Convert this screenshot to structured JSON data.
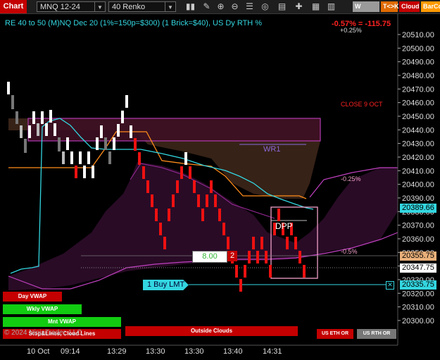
{
  "toolbar": {
    "chart_button": "Chart",
    "symbol": "MNQ 12-24",
    "bar_type": "40 Renko",
    "pills": {
      "vwap": "W VWAP",
      "tk": "T<>K",
      "cloud": "Cloud",
      "barco": "BarCo"
    },
    "icons": [
      "bar-style-icon",
      "drawing-tools-icon",
      "zoom-in-icon",
      "zoom-out-icon",
      "properties-icon",
      "strategy-icon",
      "template-icon",
      "global-draw-icon",
      "data-box-icon",
      "chart-trader-icon"
    ]
  },
  "header": {
    "title": "RE 40 to 50 (M)NQ Dec 20 (1%=150p=$300) (1 Brick=$40), US Dy RTH %",
    "change_top": "-0.57% = -115.75",
    "change_pct": "+0.25%"
  },
  "chart_labels": {
    "close": "CLOSE 9 OCT",
    "wr1": "WR1",
    "dpp": "DPP",
    "minus025": "-0.25%",
    "minus05": "-0.5%",
    "one_buy_lmt": "1 Buy LMT",
    "order_qty": "8.00",
    "order_count": "2",
    "copyright": "© 2024 NinjaTrader, LLC"
  },
  "legend_buttons": {
    "day_vwap": "Day VWAP",
    "wkly_vwap": "Wkly VWAP",
    "mnt_vwap": "Mnt VWAP",
    "stop_lines": "Stop&Lines, Cloud Lines",
    "outside_clouds": "Outside Clouds",
    "us_eth_or": "US ETH OR",
    "us_rth_or": "US RTH OR"
  },
  "price_axis": {
    "ticks": [
      "20510.00",
      "20500.00",
      "20490.00",
      "20480.00",
      "20470.00",
      "20460.00",
      "20450.00",
      "20440.00",
      "20430.00",
      "20420.00",
      "20410.00",
      "20400.00",
      "20390.00",
      "20380.00",
      "20370.00",
      "20360.00",
      "20350.00",
      "20340.00",
      "20330.00",
      "20320.00",
      "20310.00",
      "20300.00"
    ],
    "markers": {
      "cyan": "20389.66",
      "tan": "20355.75",
      "white": "20347.75",
      "buy": "20335.75"
    }
  },
  "time_axis": [
    "10 Oct",
    "09:14",
    "13:29",
    "13:30",
    "13:30",
    "13:40",
    "14:31"
  ],
  "colors": {
    "up_brick": "#ffffff",
    "down_brick": "#ee1111",
    "cyan_line": "#33d6e0",
    "orange_line": "#ff8c1a",
    "purple_line": "#c040c0",
    "accent_red": "#c40000"
  }
}
